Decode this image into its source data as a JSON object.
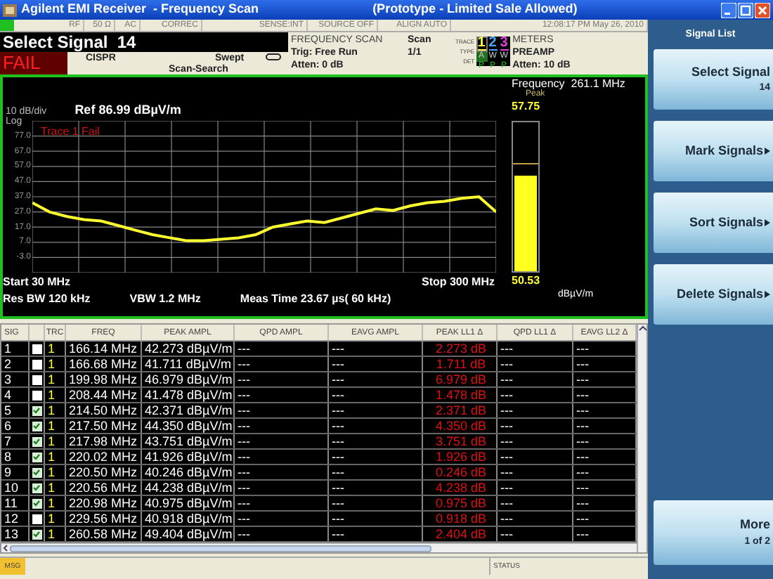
{
  "window": {
    "title": "Agilent EMI Receiver  - Frequency Scan",
    "subtitle": "(Prototype - Limited Sale Allowed)"
  },
  "status_strip": [
    "RF",
    "50 Ω",
    "AC",
    "CORREC",
    "SENSE:INT",
    "SOURCE OFF",
    "ALIGN AUTO",
    "12:08:17 PM May 26, 2010"
  ],
  "header": {
    "title": "Select Signal  14",
    "verdict": "FAIL",
    "detector_standard": "CISPR",
    "sweep": "Swept",
    "scan_mode": "Scan-Search",
    "scan_info": [
      "FREQUENCY SCAN",
      "Trig: Free Run",
      "Atten: 0 dB"
    ],
    "scan_count": [
      "Scan",
      "1/1"
    ],
    "trace_labels": [
      "TRACE",
      "TYPE",
      "DET"
    ],
    "traces": [
      {
        "number": "1",
        "type": "A",
        "det": "P",
        "color": "#ffff40",
        "selected": true
      },
      {
        "number": "2",
        "type": "W",
        "det": "P",
        "color": "#4aa8ff",
        "selected": false
      },
      {
        "number": "3",
        "type": "W",
        "det": "P",
        "color": "#e040e0",
        "selected": false
      }
    ],
    "meters_info": [
      "METERS",
      "PREAMP",
      "Atten: 10 dB"
    ]
  },
  "graph": {
    "scale": "10 dB/div",
    "scale_type": "Log",
    "reference": "Ref 86.99 dBµV/m",
    "fail_message": "Trace 1 Fail",
    "chart_data": {
      "type": "line",
      "categories": [
        null,
        null,
        null,
        null,
        null,
        null,
        null,
        null,
        null,
        null,
        null,
        null,
        null,
        null,
        null,
        null,
        null,
        null,
        null,
        null,
        null,
        null,
        null,
        null,
        null,
        null,
        null,
        null
      ],
      "series": [
        {
          "color": "#ffff30",
          "values": [
            33,
            27,
            24,
            22,
            21,
            18,
            15,
            12,
            10,
            8,
            8,
            9,
            10,
            12,
            17,
            19,
            21,
            20,
            23,
            26,
            29,
            28,
            31,
            33,
            34,
            36,
            37,
            27
          ]
        }
      ],
      "ylim": [
        -13,
        87
      ],
      "grid": true,
      "yticks": [
        {
          "value": 77,
          "label": "77.0"
        },
        {
          "value": 67,
          "label": "67.0"
        },
        {
          "value": 57,
          "label": "57.0"
        },
        {
          "value": 47,
          "label": "47.0"
        },
        {
          "value": 37,
          "label": "37.0"
        },
        {
          "value": 27,
          "label": "27.0"
        },
        {
          "value": 17,
          "label": "17.0"
        },
        {
          "value": 7,
          "label": "7.0"
        },
        {
          "value": -3,
          "label": "-3.0"
        }
      ]
    },
    "start": "Start 30 MHz",
    "stop": "Stop 300 MHz",
    "res_bw": "Res BW 120 kHz",
    "vbw": "VBW 1.2 MHz",
    "meas_time": "Meas Time 23.67 µs( 60 kHz)"
  },
  "meter": {
    "frequency": "Frequency  261.1 MHz",
    "mode": "Peak",
    "peak_reading": "57.75",
    "reading": "50.53",
    "unit": "dBµV/m",
    "level": 0.64,
    "peak_hold": {
      "level": 0.72
    }
  },
  "table": {
    "columns": [
      "SIG",
      "TRC",
      "FREQ",
      "PEAK AMPL",
      "QPD AMPL",
      "EAVG AMPL",
      "PEAK LL1 Δ",
      "QPD LL1 Δ",
      "EAVG LL2 Δ"
    ],
    "rows": [
      {
        "checked": false,
        "cells": [
          "1",
          "1",
          "166.14 MHz",
          "42.273 dBµV/m",
          "---",
          "---",
          "2.273 dB",
          "---",
          "---"
        ]
      },
      {
        "checked": false,
        "cells": [
          "2",
          "1",
          "166.68 MHz",
          "41.711 dBµV/m",
          "---",
          "---",
          "1.711 dB",
          "---",
          "---"
        ]
      },
      {
        "checked": false,
        "cells": [
          "3",
          "1",
          "199.98 MHz",
          "46.979 dBµV/m",
          "---",
          "---",
          "6.979 dB",
          "---",
          "---"
        ]
      },
      {
        "checked": false,
        "cells": [
          "4",
          "1",
          "208.44 MHz",
          "41.478 dBµV/m",
          "---",
          "---",
          "1.478 dB",
          "---",
          "---"
        ]
      },
      {
        "checked": true,
        "cells": [
          "5",
          "1",
          "214.50 MHz",
          "42.371 dBµV/m",
          "---",
          "---",
          "2.371 dB",
          "---",
          "---"
        ]
      },
      {
        "checked": true,
        "cells": [
          "6",
          "1",
          "217.50 MHz",
          "44.350 dBµV/m",
          "---",
          "---",
          "4.350 dB",
          "---",
          "---"
        ]
      },
      {
        "checked": true,
        "cells": [
          "7",
          "1",
          "217.98 MHz",
          "43.751 dBµV/m",
          "---",
          "---",
          "3.751 dB",
          "---",
          "---"
        ]
      },
      {
        "checked": true,
        "cells": [
          "8",
          "1",
          "220.02 MHz",
          "41.926 dBµV/m",
          "---",
          "---",
          "1.926 dB",
          "---",
          "---"
        ]
      },
      {
        "checked": true,
        "cells": [
          "9",
          "1",
          "220.50 MHz",
          "40.246 dBµV/m",
          "---",
          "---",
          "0.246 dB",
          "---",
          "---"
        ]
      },
      {
        "checked": true,
        "cells": [
          "10",
          "1",
          "220.56 MHz",
          "44.238 dBµV/m",
          "---",
          "---",
          "4.238 dB",
          "---",
          "---"
        ]
      },
      {
        "checked": true,
        "cells": [
          "11",
          "1",
          "220.98 MHz",
          "40.975 dBµV/m",
          "---",
          "---",
          "0.975 dB",
          "---",
          "---"
        ]
      },
      {
        "checked": false,
        "cells": [
          "12",
          "1",
          "229.56 MHz",
          "40.918 dBµV/m",
          "---",
          "---",
          "0.918 dB",
          "---",
          "---"
        ]
      },
      {
        "checked": true,
        "cells": [
          "13",
          "1",
          "260.58 MHz",
          "49.404 dBµV/m",
          "---",
          "---",
          "2.404 dB",
          "---",
          "---"
        ]
      }
    ]
  },
  "status_bar": {
    "message_label": "MSG",
    "status_label": "STATUS"
  },
  "softkeys": {
    "title": "Signal List",
    "keys": [
      {
        "label": "Select Signal",
        "value": "14",
        "submenu": false
      },
      {
        "label": "Mark Signals",
        "submenu": true
      },
      {
        "label": "Sort Signals",
        "submenu": true
      },
      {
        "label": "Delete Signals",
        "submenu": true
      }
    ],
    "more": {
      "label": "More",
      "page": "1 of 2"
    }
  }
}
